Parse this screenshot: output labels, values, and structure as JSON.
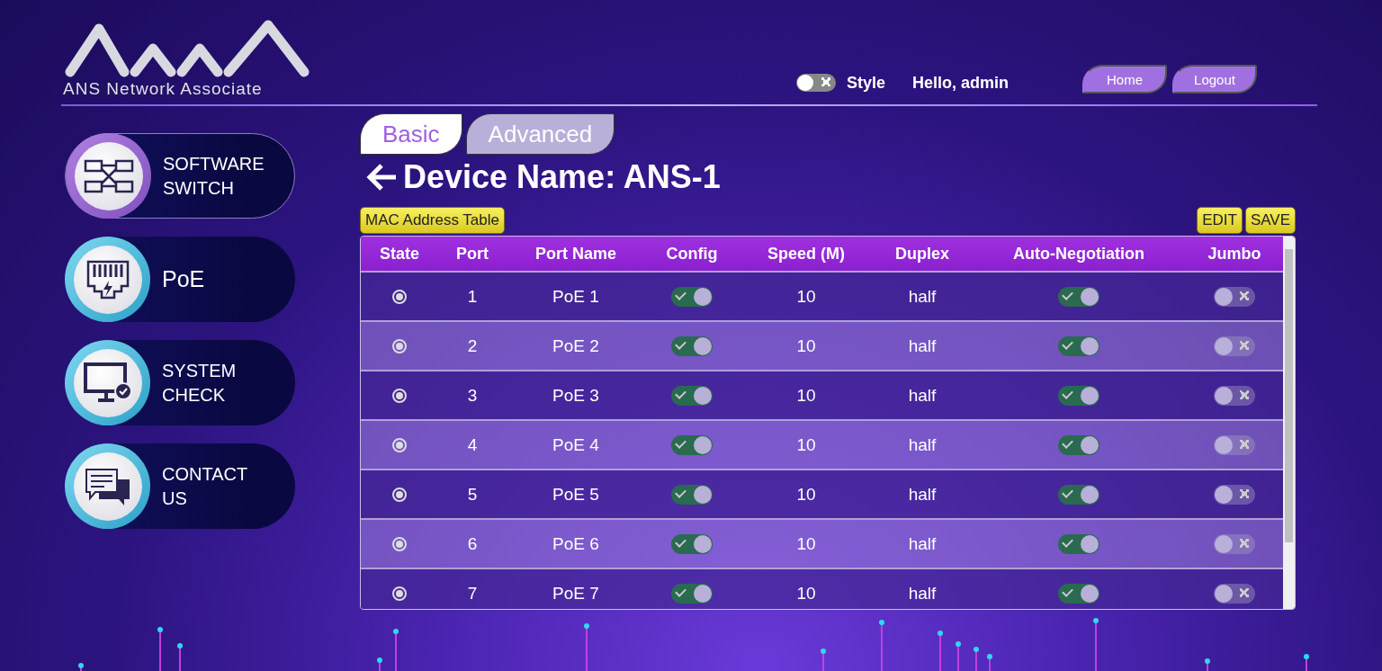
{
  "logo": {
    "text": "ANS Network Associate"
  },
  "header": {
    "style_toggle": {
      "label": "Style",
      "on": false
    },
    "greeting": "Hello, admin",
    "buttons": [
      "Home",
      "Logout"
    ]
  },
  "sidebar": {
    "items": [
      {
        "label": "SOFTWARE SWITCH",
        "kind": "switch",
        "selected": true
      },
      {
        "label": "PoE",
        "kind": "poe",
        "selected": false
      },
      {
        "label": "SYSTEM CHECK",
        "kind": "check",
        "selected": false
      },
      {
        "label": "CONTACT US",
        "kind": "contact",
        "selected": false
      }
    ]
  },
  "tabs": [
    {
      "label": "Basic",
      "selected": true
    },
    {
      "label": "Advanced",
      "selected": false
    }
  ],
  "title": "Device Name: ANS-1",
  "actions": {
    "left": "MAC Address Table",
    "right": [
      "EDIT",
      "SAVE"
    ]
  },
  "table": {
    "columns": [
      "State",
      "Port",
      "Port Name",
      "Config",
      "Speed (M)",
      "Duplex",
      "Auto-Negotiation",
      "Jumbo"
    ],
    "rows": [
      {
        "state_on": true,
        "port": "1",
        "name": "PoE 1",
        "config": true,
        "speed": "10",
        "duplex": "half",
        "auto_negotiation": true,
        "jumbo": false
      },
      {
        "state_on": true,
        "port": "2",
        "name": "PoE 2",
        "config": true,
        "speed": "10",
        "duplex": "half",
        "auto_negotiation": true,
        "jumbo": false
      },
      {
        "state_on": true,
        "port": "3",
        "name": "PoE 3",
        "config": true,
        "speed": "10",
        "duplex": "half",
        "auto_negotiation": true,
        "jumbo": false
      },
      {
        "state_on": true,
        "port": "4",
        "name": "PoE 4",
        "config": true,
        "speed": "10",
        "duplex": "half",
        "auto_negotiation": true,
        "jumbo": false
      },
      {
        "state_on": true,
        "port": "5",
        "name": "PoE 5",
        "config": true,
        "speed": "10",
        "duplex": "half",
        "auto_negotiation": true,
        "jumbo": false
      },
      {
        "state_on": true,
        "port": "6",
        "name": "PoE 6",
        "config": true,
        "speed": "10",
        "duplex": "half",
        "auto_negotiation": true,
        "jumbo": false
      },
      {
        "state_on": true,
        "port": "7",
        "name": "PoE 7",
        "config": true,
        "speed": "10",
        "duplex": "half",
        "auto_negotiation": true,
        "jumbo": false
      }
    ]
  }
}
